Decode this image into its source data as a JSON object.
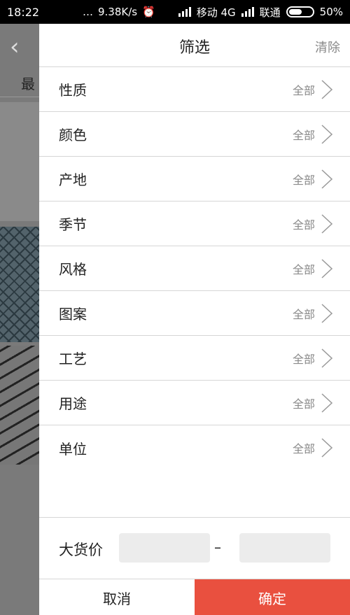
{
  "status_bar": {
    "time": "18:22",
    "network_speed": "9.38K/s",
    "carrier1": "移动 4G",
    "carrier2": "联通",
    "battery": "50%"
  },
  "background": {
    "back_icon": "chevron-left-icon",
    "tab_partial": "最"
  },
  "panel": {
    "title": "筛选",
    "clear_label": "清除",
    "filters": [
      {
        "label": "性质",
        "value": "全部"
      },
      {
        "label": "颜色",
        "value": "全部"
      },
      {
        "label": "产地",
        "value": "全部"
      },
      {
        "label": "季节",
        "value": "全部"
      },
      {
        "label": "风格",
        "value": "全部"
      },
      {
        "label": "图案",
        "value": "全部"
      },
      {
        "label": "工艺",
        "value": "全部"
      },
      {
        "label": "用途",
        "value": "全部"
      },
      {
        "label": "单位",
        "value": "全部"
      }
    ],
    "price": {
      "label": "大货价",
      "dash": "–"
    },
    "cancel_label": "取消",
    "confirm_label": "确定"
  },
  "colors": {
    "accent": "#e9503f",
    "divider": "#d6d6d6",
    "input_bg": "#ececec"
  }
}
